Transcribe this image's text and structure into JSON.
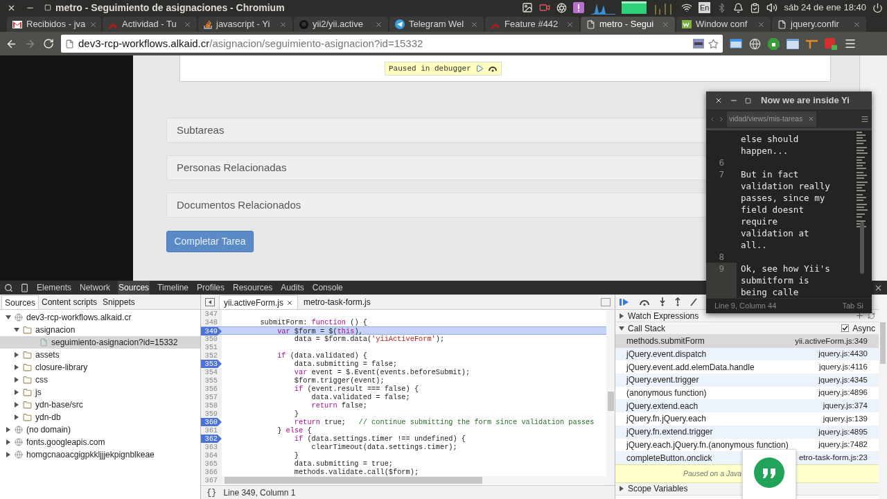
{
  "system_bar": {
    "window_title": "metro - Seguimiento de asignaciones - Chromium",
    "keyboard": "En",
    "clock": "sáb 24 de ene 18:40"
  },
  "browser_tabs": [
    {
      "title": "Recibidos - jva",
      "kind": "mail",
      "selected": false
    },
    {
      "title": "Actividad - Tu",
      "kind": "redmine",
      "selected": false
    },
    {
      "title": "javascript - Yi",
      "kind": "stack",
      "selected": false
    },
    {
      "title": "yii2/yii.active",
      "kind": "github",
      "selected": false
    },
    {
      "title": "Telegram Wel",
      "kind": "telegram",
      "selected": false
    },
    {
      "title": "Feature #442",
      "kind": "redmine",
      "selected": false
    },
    {
      "title": "metro - Segui",
      "kind": "page",
      "selected": true
    },
    {
      "title": "Window conf",
      "kind": "window",
      "selected": false
    },
    {
      "title": "jquery.confir",
      "kind": "page",
      "selected": false
    }
  ],
  "address_bar": {
    "host": "dev3-rcp-workflows.alkaid.cr",
    "path": "/asignacion/seguimiento-asignacion?id=15332"
  },
  "page": {
    "paused_badge": "Paused in debugger",
    "panels": [
      "Subtareas",
      "Personas Relacionadas",
      "Documentos Relacionados"
    ],
    "button": "Completar Tarea"
  },
  "devtools": {
    "panel_tabs": [
      {
        "label": "Elements",
        "selected": false
      },
      {
        "label": "Network",
        "selected": false
      },
      {
        "label": "Sources",
        "selected": true
      },
      {
        "label": "Timeline",
        "selected": false
      },
      {
        "label": "Profiles",
        "selected": false
      },
      {
        "label": "Resources",
        "selected": false
      },
      {
        "label": "Audits",
        "selected": false
      },
      {
        "label": "Console",
        "selected": false
      }
    ],
    "navigator_tabs": [
      {
        "label": "Sources",
        "selected": true
      },
      {
        "label": "Content scripts",
        "selected": false
      },
      {
        "label": "Snippets",
        "selected": false
      }
    ],
    "tree": [
      {
        "label": "dev3-rcp-workflows.alkaid.cr",
        "kind": "domain",
        "expanded": true,
        "selected": false,
        "children": [
          {
            "label": "asignacion",
            "kind": "folder",
            "expanded": true,
            "selected": false,
            "children": [
              {
                "label": "seguimiento-asignacion?id=15332",
                "kind": "file",
                "selected": true
              }
            ]
          },
          {
            "label": "assets",
            "kind": "folder",
            "expanded": false,
            "selected": false
          },
          {
            "label": "closure-library",
            "kind": "folder",
            "expanded": false,
            "selected": false
          },
          {
            "label": "css",
            "kind": "folder",
            "expanded": false,
            "selected": false
          },
          {
            "label": "js",
            "kind": "folder",
            "expanded": false,
            "selected": false
          },
          {
            "label": "ydn-base/src",
            "kind": "folder",
            "expanded": false,
            "selected": false
          },
          {
            "label": "ydn-db",
            "kind": "folder",
            "expanded": false,
            "selected": false
          }
        ]
      },
      {
        "label": "(no domain)",
        "kind": "domain",
        "expanded": false,
        "selected": false
      },
      {
        "label": "fonts.googleapis.com",
        "kind": "domain",
        "expanded": false,
        "selected": false
      },
      {
        "label": "homgcnaoacgigpkkljjjekpignblkeae",
        "kind": "domain",
        "expanded": false,
        "selected": false
      }
    ],
    "editor_tabs": [
      {
        "label": "yii.activeForm.js",
        "selected": true
      },
      {
        "label": "metro-task-form.js",
        "selected": false
      }
    ],
    "lines": [
      {
        "number": "347",
        "breakpoint": false,
        "current": false
      },
      {
        "number": "348",
        "breakpoint": false,
        "current": false,
        "tokens": [
          {
            "text": "        submitForm: ",
            "kind": "plain"
          },
          {
            "text": "function",
            "kind": "keyword"
          },
          {
            "text": " () {",
            "kind": "plain"
          }
        ]
      },
      {
        "number": "349",
        "breakpoint": true,
        "current": true,
        "tokens": [
          {
            "text": "            var",
            "kind": "keyword"
          },
          {
            "text": " $form = $(",
            "kind": "plain"
          },
          {
            "text": "this",
            "kind": "keyword"
          },
          {
            "text": "),",
            "kind": "plain"
          }
        ]
      },
      {
        "number": "350",
        "breakpoint": false,
        "current": false,
        "tokens": [
          {
            "text": "                data = $form.data(",
            "kind": "plain"
          },
          {
            "text": "'yiiActiveForm'",
            "kind": "string"
          },
          {
            "text": ");",
            "kind": "plain"
          }
        ]
      },
      {
        "number": "351",
        "breakpoint": false,
        "current": false
      },
      {
        "number": "352",
        "breakpoint": false,
        "current": false,
        "tokens": [
          {
            "text": "            if",
            "kind": "keyword"
          },
          {
            "text": " (data.validated) {",
            "kind": "plain"
          }
        ]
      },
      {
        "number": "353",
        "breakpoint": true,
        "current": false,
        "tokens": [
          {
            "text": "                data.submitting = false;",
            "kind": "plain"
          }
        ]
      },
      {
        "number": "354",
        "breakpoint": false,
        "current": false,
        "tokens": [
          {
            "text": "                var",
            "kind": "keyword"
          },
          {
            "text": " event = $.Event(events.beforeSubmit);",
            "kind": "plain"
          }
        ]
      },
      {
        "number": "355",
        "breakpoint": false,
        "current": false,
        "tokens": [
          {
            "text": "                $form.trigger(event);",
            "kind": "plain"
          }
        ]
      },
      {
        "number": "356",
        "breakpoint": false,
        "current": false,
        "tokens": [
          {
            "text": "                if",
            "kind": "keyword"
          },
          {
            "text": " (event.result === false) {",
            "kind": "plain"
          }
        ]
      },
      {
        "number": "357",
        "breakpoint": false,
        "current": false,
        "tokens": [
          {
            "text": "                    data.validated = false;",
            "kind": "plain"
          }
        ]
      },
      {
        "number": "358",
        "breakpoint": false,
        "current": false,
        "tokens": [
          {
            "text": "                    return",
            "kind": "keyword"
          },
          {
            "text": " false;",
            "kind": "plain"
          }
        ]
      },
      {
        "number": "359",
        "breakpoint": false,
        "current": false,
        "tokens": [
          {
            "text": "                }",
            "kind": "plain"
          }
        ]
      },
      {
        "number": "360",
        "breakpoint": true,
        "current": false,
        "tokens": [
          {
            "text": "                return",
            "kind": "keyword"
          },
          {
            "text": " true;   ",
            "kind": "plain"
          },
          {
            "text": "// continue submitting the form since validation passes",
            "kind": "comment"
          }
        ]
      },
      {
        "number": "361",
        "breakpoint": false,
        "current": false,
        "tokens": [
          {
            "text": "            } ",
            "kind": "plain"
          },
          {
            "text": "else",
            "kind": "keyword"
          },
          {
            "text": " {",
            "kind": "plain"
          }
        ]
      },
      {
        "number": "362",
        "breakpoint": true,
        "current": false,
        "tokens": [
          {
            "text": "                if",
            "kind": "keyword"
          },
          {
            "text": " (data.settings.timer !== undefined) {",
            "kind": "plain"
          }
        ]
      },
      {
        "number": "363",
        "breakpoint": false,
        "current": false,
        "tokens": [
          {
            "text": "                    clearTimeout(data.settings.timer);",
            "kind": "plain"
          }
        ]
      },
      {
        "number": "364",
        "breakpoint": false,
        "current": false,
        "tokens": [
          {
            "text": "                }",
            "kind": "plain"
          }
        ]
      },
      {
        "number": "365",
        "breakpoint": false,
        "current": false,
        "tokens": [
          {
            "text": "                data.submitting = true;",
            "kind": "plain"
          }
        ]
      },
      {
        "number": "366",
        "breakpoint": false,
        "current": false,
        "tokens": [
          {
            "text": "                methods.validate.call($form);",
            "kind": "plain"
          }
        ]
      }
    ],
    "last_line_number": "367",
    "pretty_print": "{}",
    "editor_status": "Line 349, Column 1",
    "watch_title": "Watch Expressions",
    "watch_expanded": false,
    "callstack_title": "Call Stack",
    "callstack_expanded": true,
    "async": {
      "label": "Async",
      "checked": true
    },
    "frames": [
      {
        "name": "methods.submitForm",
        "location": "yii.activeForm.js:349",
        "selected": true
      },
      {
        "name": "jQuery.event.dispatch",
        "location": "jquery.js:4430",
        "selected": false
      },
      {
        "name": "jQuery.event.add.elemData.handle",
        "location": "jquery.js:4116",
        "selected": false
      },
      {
        "name": "jQuery.event.trigger",
        "location": "jquery.js:4345",
        "selected": false
      },
      {
        "name": "(anonymous function)",
        "location": "jquery.js:4896",
        "selected": false
      },
      {
        "name": "jQuery.extend.each",
        "location": "jquery.js:374",
        "selected": false
      },
      {
        "name": "jQuery.fn.jQuery.each",
        "location": "jquery.js:139",
        "selected": false
      },
      {
        "name": "jQuery.fn.extend.trigger",
        "location": "jquery.js:4895",
        "selected": false
      },
      {
        "name": "jQuery.each.jQuery.fn.(anonymous function)",
        "location": "jquery.js:7482",
        "selected": false
      },
      {
        "name": "completeButton.onclick",
        "location": "etro-task-form.js:23",
        "selected": false
      }
    ],
    "paused_message": "Paused on a Java",
    "scope_title": "Scope Variables",
    "scope_expanded": false
  },
  "text_editor": {
    "title": "Now we are inside Yi",
    "tab": "vidad/views/mis-tareas",
    "lines": [
      {
        "rows": [
          "else should",
          "happen..."
        ],
        "current": false
      },
      {
        "number": "6",
        "current": false
      },
      {
        "number": "7",
        "rows": [
          "But in fact",
          "validation really",
          "passes, since my",
          "field doesnt",
          "require",
          "validation at",
          "all.."
        ],
        "current": false
      },
      {
        "number": "8",
        "current": false
      },
      {
        "number": "9",
        "rows": [
          "Ok, see how Yii's",
          "submitform is",
          "being calle"
        ],
        "current": true
      }
    ],
    "status": "Line 9, Column 44",
    "indent": "Tab Si"
  }
}
